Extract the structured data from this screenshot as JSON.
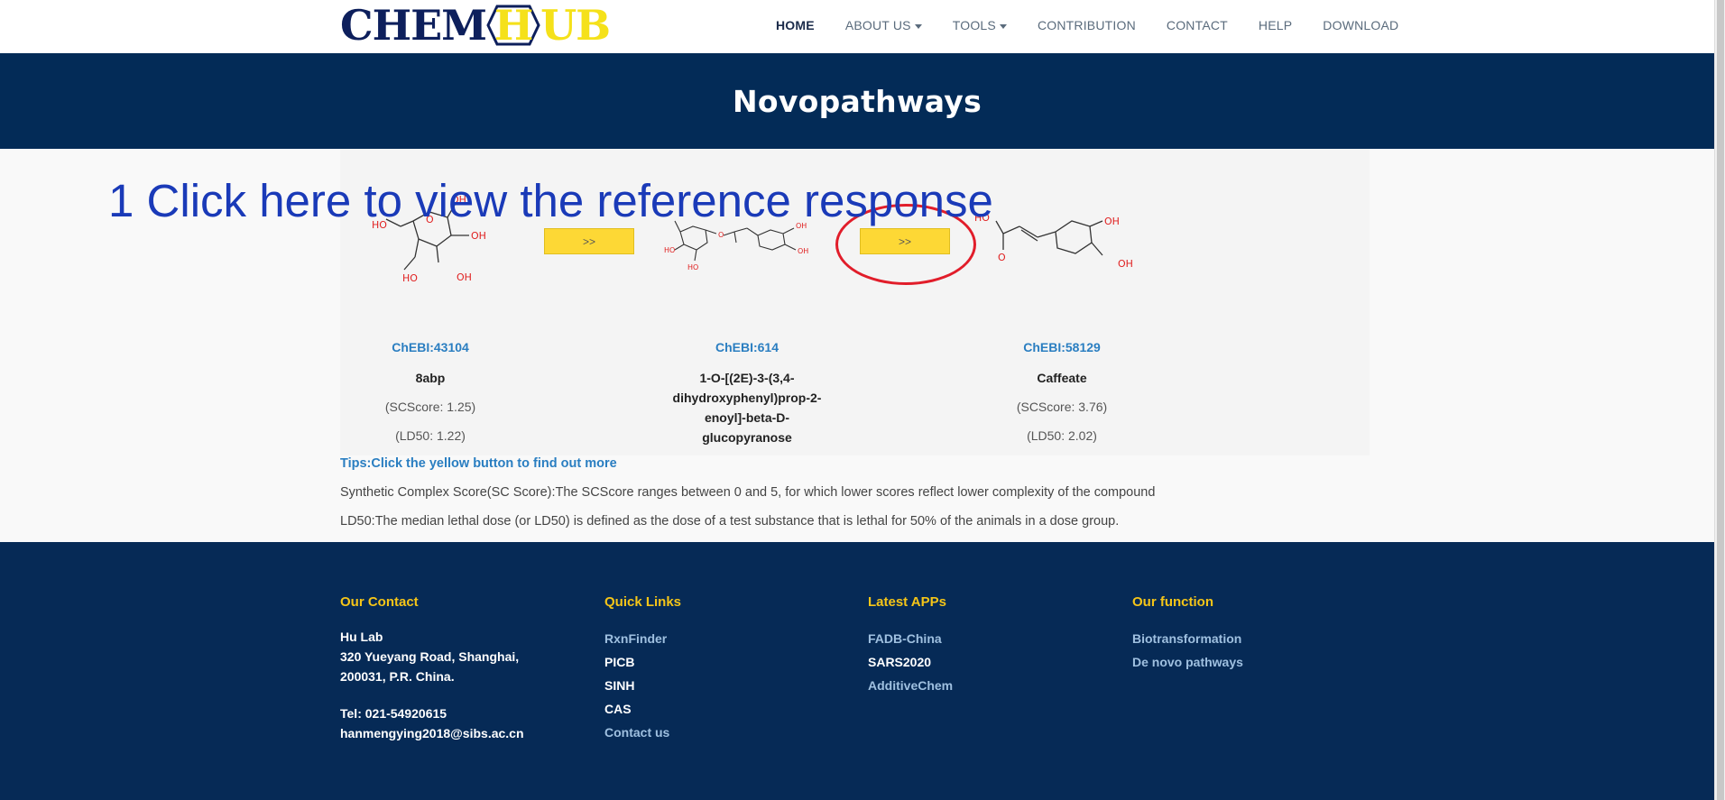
{
  "navbar": {
    "logo": {
      "part1": "CHEM",
      "hex_letter": "H",
      "part2": "UB"
    },
    "items": [
      {
        "label": "HOME",
        "active": true
      },
      {
        "label": "ABOUT US",
        "dropdown": true
      },
      {
        "label": "TOOLS",
        "dropdown": true
      },
      {
        "label": "CONTRIBUTION"
      },
      {
        "label": "CONTACT"
      },
      {
        "label": "HELP"
      },
      {
        "label": "DOWNLOAD"
      }
    ]
  },
  "banner": {
    "title": "Novopathways"
  },
  "overlay": {
    "link_text": "1 Click here to view the reference response"
  },
  "pathway": {
    "arrow_label": ">>",
    "compounds": [
      {
        "id": "ChEBI:43104",
        "name": "8abp",
        "scscore": "(SCScore: 1.25)",
        "ld50": "(LD50: 1.22)"
      },
      {
        "id": "ChEBI:614",
        "name": "1-O-[(2E)-3-(3,4-dihydroxyphenyl)prop-2-enoyl]-beta-D-glucopyranose",
        "scscore": "",
        "ld50": ""
      },
      {
        "id": "ChEBI:58129",
        "name": "Caffeate",
        "scscore": "(SCScore: 3.76)",
        "ld50": "(LD50: 2.02)"
      }
    ],
    "atom_labels": {
      "oh": "OH",
      "ho": "HO",
      "o": "O"
    }
  },
  "tips": {
    "heading": "Tips:Click the yellow button to find out more",
    "sc_note": "Synthetic Complex Score(SC Score):The SCScore ranges between 0 and 5, for which lower scores reflect lower complexity of the compound",
    "ld50_note": "LD50:The median lethal dose (or LD50) is defined as the dose of a test substance that is lethal for 50% of the animals in a dose group."
  },
  "footer": {
    "contact": {
      "heading": "Our Contact",
      "org": "Hu Lab",
      "address1": "320 Yueyang Road, Shanghai,",
      "address2": "200031, P.R. China.",
      "tel": "Tel: 021-54920615",
      "email": "hanmengying2018@sibs.ac.cn"
    },
    "quick_links": {
      "heading": "Quick Links",
      "items": [
        "RxnFinder",
        "PICB",
        "SINH",
        "CAS",
        "Contact us"
      ]
    },
    "latest_apps": {
      "heading": "Latest APPs",
      "items": [
        "FADB-China",
        "SARS2020",
        "AdditiveChem"
      ]
    },
    "our_function": {
      "heading": "Our function",
      "items": [
        "Biotransformation",
        "De novo pathways"
      ]
    }
  },
  "colors": {
    "navy": "#032b57",
    "footer": "#062a56",
    "accent_yellow": "#fdd835",
    "link_blue": "#2a7ec1",
    "overlay_blue": "#1a3ab8",
    "circle_red": "#e11d2a"
  }
}
